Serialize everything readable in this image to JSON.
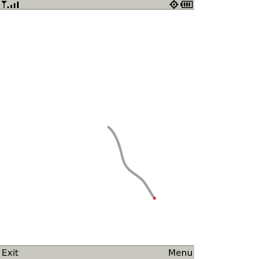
{
  "softkeys": {
    "left_label": "Exit",
    "right_label": "Menu"
  },
  "status_bar": {
    "icons": [
      "signal-strength-icon",
      "settings-icon",
      "battery-icon"
    ]
  },
  "drawing": {
    "stroke_color": "#a0a0a0",
    "cursor_color": "#e8001c"
  },
  "colors": {
    "bar_background": "#c8c8c0",
    "canvas_background": "#ffffff"
  }
}
